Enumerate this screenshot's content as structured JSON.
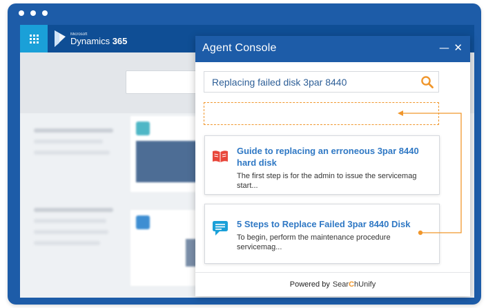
{
  "d365": {
    "microsoft_label": "Microsoft",
    "product_name": "Dynamics",
    "product_version": "365"
  },
  "console": {
    "title": "Agent Console",
    "search": {
      "query": "Replacing failed disk 3par 8440"
    },
    "results": [
      {
        "title": "Guide to replacing an erroneous 3par 8440 hard disk",
        "description": "The first step is for the admin to issue the servicemag start...",
        "icon": "book-icon"
      },
      {
        "title": "5 Steps to Replace Failed 3par 8440 Disk",
        "description": "To begin, perform the maintenance procedure servicemag...",
        "icon": "chat-icon"
      }
    ],
    "footer": {
      "powered_by": "Powered by",
      "brand_before": "Sear",
      "brand_after": "hUnify"
    }
  },
  "colors": {
    "window_blue": "#1d5ca8",
    "grid_button": "#1aa0d8",
    "accent_orange": "#f0962b",
    "result_title": "#2f78c4"
  }
}
